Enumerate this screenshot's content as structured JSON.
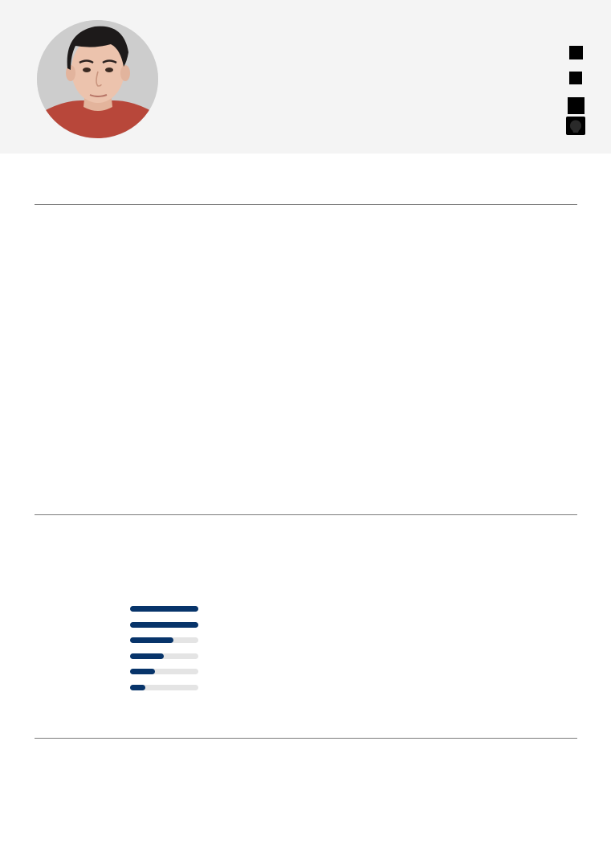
{
  "profile": {
    "avatar_alt": "profile-photo"
  },
  "contact_icons": [
    "email-icon",
    "phone-icon",
    "linkedin-icon",
    "github-icon"
  ],
  "colors": {
    "header_bg": "#f4f4f4",
    "accent": "#07346a",
    "bar_track": "#e4e4e4",
    "divider": "#7a7a7a"
  },
  "skills": {
    "levels": [
      1.0,
      1.0,
      0.64,
      0.49,
      0.36,
      0.22
    ]
  }
}
